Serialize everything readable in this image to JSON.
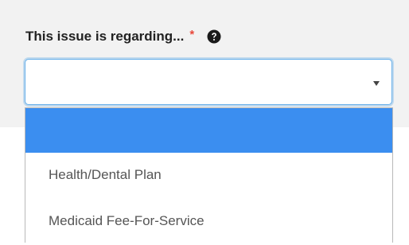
{
  "field": {
    "label": "This issue is regarding...",
    "required_marker": "*",
    "help_icon": "question-circle-icon",
    "selected_value": ""
  },
  "dropdown": {
    "highlighted_color": "#3b8ef0",
    "options": [
      {
        "label": "",
        "highlighted": true
      },
      {
        "label": "Health/Dental Plan",
        "highlighted": false
      },
      {
        "label": "Medicaid Fee-For-Service",
        "highlighted": false
      }
    ]
  },
  "colors": {
    "required": "#e8483b",
    "focus_border": "#66afe9",
    "panel_bg": "#f2f2f2"
  }
}
